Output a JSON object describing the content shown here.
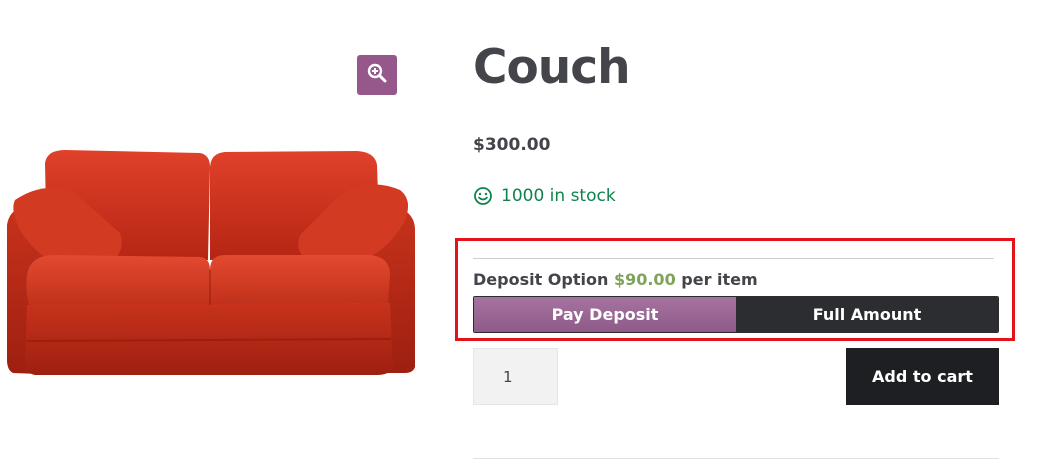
{
  "product": {
    "title": "Couch",
    "price": "$300.00",
    "stock": "1000 in stock"
  },
  "deposit": {
    "label_prefix": "Deposit Option",
    "amount": "$90.00",
    "label_suffix": "per item",
    "options": [
      "Pay Deposit",
      "Full Amount"
    ],
    "selected": "Pay Deposit"
  },
  "cart": {
    "quantity": "1",
    "add_to_cart_label": "Add to cart"
  },
  "icons": {
    "zoom": "zoom-in-icon",
    "stock": "smiley-icon"
  },
  "colors": {
    "accent": "#96588a",
    "stock_green": "#0f834d",
    "deposit_amount": "#7fa35a",
    "highlight": "#e3121b",
    "dark_button": "#1d1f22"
  }
}
